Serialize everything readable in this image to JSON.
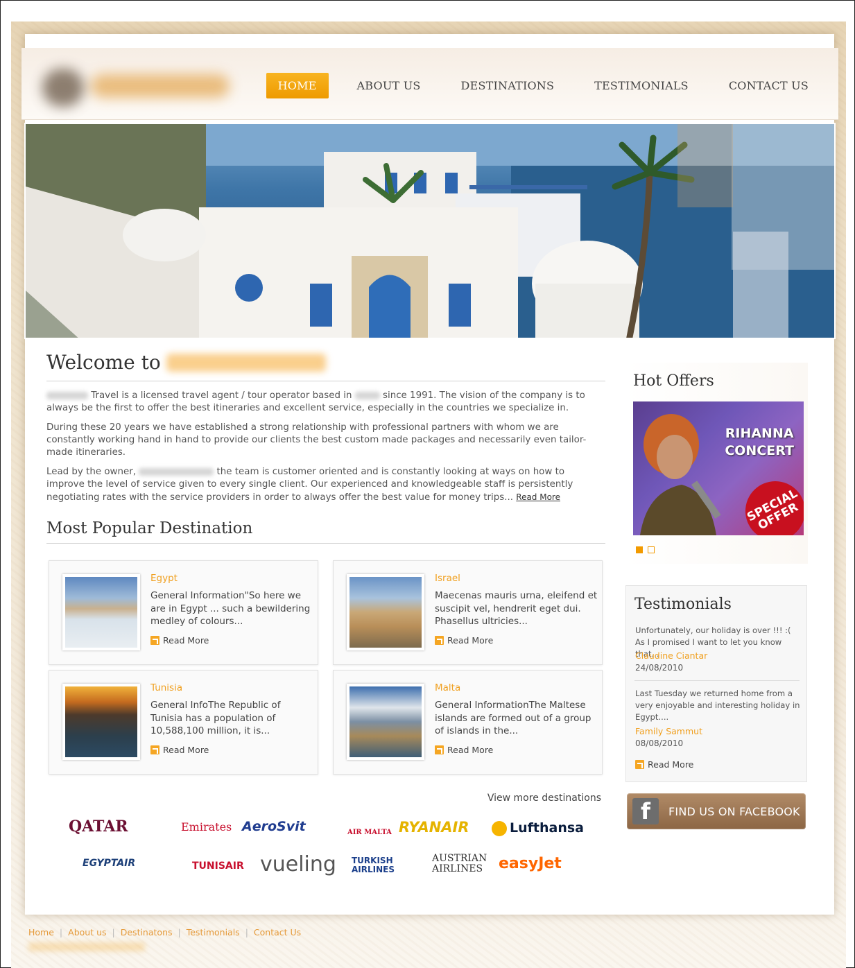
{
  "nav": {
    "items": [
      "HOME",
      "ABOUT US",
      "DESTINATIONS",
      "TESTIMONIALS",
      "CONTACT US"
    ],
    "active": "HOME"
  },
  "welcome": {
    "heading": "Welcome to",
    "paragraphs": [
      "Travel is a licensed travel agent / tour operator based in",
      "since 1991. The vision of the company is to always be the first to offer the best itineraries and excellent service, especially in the countries we specialize in.",
      "During these 20 years we have established a strong relationship with professional partners with whom we are constantly working hand in hand to provide our clients the best custom made packages and necessarily even tailor-made itineraries.",
      "Lead by the owner,",
      "the team is customer oriented and is constantly looking at ways on how to improve the level of service given to every single client. Our experienced and knowledgeable staff is persistently negotiating rates with the service providers in order to always offer the best value for money trips..."
    ],
    "read_more": "Read More"
  },
  "popular": {
    "heading": "Most Popular Destination",
    "cards": [
      {
        "title": "Egypt",
        "desc": "General Information\"So here we are in Egypt ... such a bewildering medley of colours...",
        "read_more": "Read More"
      },
      {
        "title": "Israel",
        "desc": "Maecenas mauris urna, eleifend et suscipit vel, hendrerit eget dui. Phasellus ultricies...",
        "read_more": "Read More"
      },
      {
        "title": "Tunisia",
        "desc": "General InfoThe Republic of Tunisia has a population of 10,588,100 million, it is...",
        "read_more": "Read More"
      },
      {
        "title": "Malta",
        "desc": "General InformationThe Maltese islands are formed out of a group of islands in the...",
        "read_more": "Read More"
      }
    ],
    "view_more": "View more destinations"
  },
  "airlines": [
    "QATAR",
    "Emirates",
    "AeroSvit",
    "AIR MALTA",
    "RYANAIR",
    "Lufthansa",
    "EGYPTAIR",
    "TUNISAIR",
    "vueling",
    "TURKISH AIRLINES",
    "AUSTRIAN AIRLINES",
    "easyJet"
  ],
  "hot_offers": {
    "heading": "Hot Offers",
    "banner_line1": "RIHANNA",
    "banner_line2": "CONCERT",
    "badge": "SPECIAL OFFER",
    "slides": 2,
    "active_slide": 1
  },
  "testimonials": {
    "heading": "Testimonials",
    "items": [
      {
        "quote": "Unfortunately, our holiday is over !!! :( As I promised I want to let you know that...",
        "name": "Claudine Ciantar",
        "date": "24/08/2010"
      },
      {
        "quote": "Last Tuesday we returned home from a very enjoyable and interesting holiday in Egypt....",
        "name": "Family Sammut",
        "date": "08/08/2010"
      }
    ],
    "read_more": "Read More"
  },
  "facebook": {
    "label": "FIND US ON FACEBOOK",
    "icon_letter": "f"
  },
  "footer": {
    "links": [
      "Home",
      "About us",
      "Destinatons",
      "Testimonials",
      "Contact Us"
    ]
  },
  "colors": {
    "accent": "#f0a020",
    "nav_active": "#f5a713",
    "facebook": "#9c7654"
  }
}
